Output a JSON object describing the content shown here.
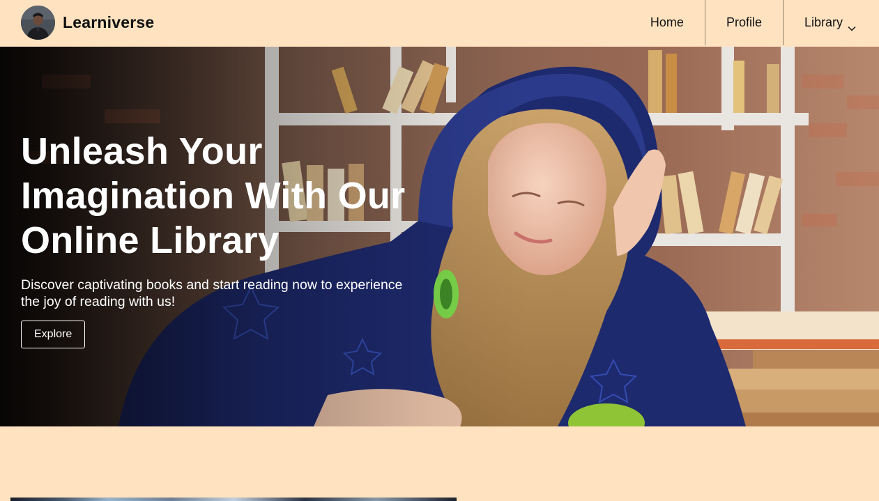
{
  "brand": {
    "name": "Learniverse"
  },
  "nav": {
    "home": "Home",
    "profile": "Profile",
    "library": "Library"
  },
  "hero": {
    "title_line1": "Unleash Your",
    "title_line2": "Imagination With Our",
    "title_line3": "Online Library",
    "subtitle_line1": "Discover captivating books and start reading now to experience",
    "subtitle_line2": "the joy of reading with us!",
    "cta": "Explore"
  },
  "colors": {
    "background": "#ffe3c1",
    "hero_text": "#ffffff",
    "nav_text": "#111111"
  },
  "icons": {
    "library_dropdown": "chevron-down-icon"
  }
}
